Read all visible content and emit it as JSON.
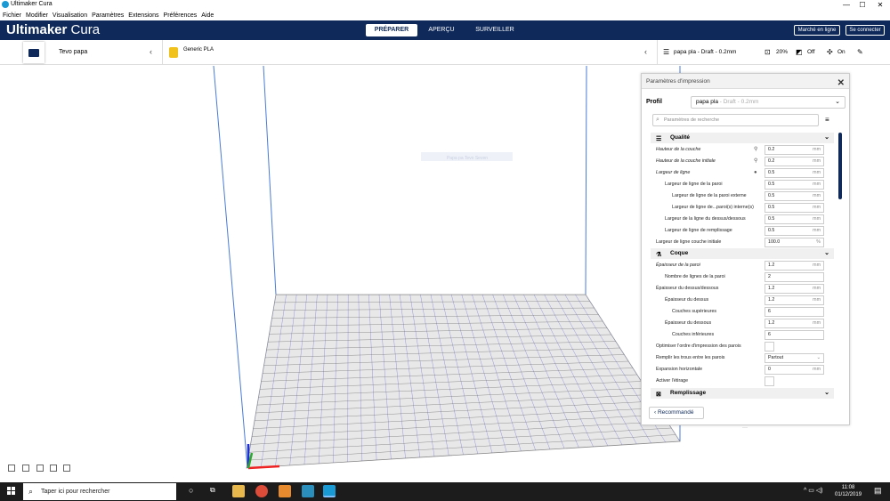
{
  "window": {
    "title": "Ultimaker Cura",
    "minimize": "—",
    "maximize": "☐",
    "close": "✕"
  },
  "menu": [
    "Fichier",
    "Modifier",
    "Visualisation",
    "Paramètres",
    "Extensions",
    "Préférences",
    "Aide"
  ],
  "header": {
    "logo_bold": "Ultimaker",
    "logo_light": " Cura",
    "tabs": [
      "PRÉPARER",
      "APERÇU",
      "SURVEILLER"
    ],
    "marketplace": "Marché en ligne",
    "signin": "Se connecter"
  },
  "toolbar": {
    "printer": "Tevo papa",
    "material": "Generic PLA",
    "profile_summary": "papa pla - Draft - 0.2mm",
    "infill": "20%",
    "support": "Off",
    "adhesion": "On"
  },
  "viewport": {
    "object_label": "Papa pa Tevo Seven"
  },
  "panel": {
    "title": "Paramètres d'impression",
    "close": "✕",
    "profile_label": "Profil",
    "profile_value": "papa pla",
    "profile_muted": " - Draft - 0.2mm",
    "search_placeholder": "Paramètres de recherche",
    "recommended": "‹  Recommandé",
    "categories": {
      "qualite": "Qualité",
      "coque": "Coque",
      "remplissage": "Remplissage"
    },
    "settings": [
      {
        "label": "Hauteur de la couche",
        "value": "0.2",
        "unit": "mm"
      },
      {
        "label": "Hauteur de la couche initiale",
        "value": "0.2",
        "unit": "mm"
      },
      {
        "label": "Largeur de ligne",
        "value": "0.5",
        "unit": "mm"
      },
      {
        "label": "Largeur de ligne de la paroi",
        "value": "0.5",
        "unit": "mm"
      },
      {
        "label": "Largeur de ligne de la paroi externe",
        "value": "0.5",
        "unit": "mm"
      },
      {
        "label": "Largeur de ligne de...paroi(s) interne(s)",
        "value": "0.5",
        "unit": "mm"
      },
      {
        "label": "Largeur de la ligne du dessus/dessous",
        "value": "0.5",
        "unit": "mm"
      },
      {
        "label": "Largeur de ligne de remplissage",
        "value": "0.5",
        "unit": "mm"
      },
      {
        "label": "Largeur de ligne couche initiale",
        "value": "100.0",
        "unit": "%"
      },
      {
        "label": "Épaisseur de la paroi",
        "value": "1.2",
        "unit": "mm"
      },
      {
        "label": "Nombre de lignes de la paroi",
        "value": "2",
        "unit": ""
      },
      {
        "label": "Épaisseur du dessus/dessous",
        "value": "1.2",
        "unit": "mm"
      },
      {
        "label": "Épaisseur du dessus",
        "value": "1.2",
        "unit": "mm"
      },
      {
        "label": "Couches supérieures",
        "value": "6",
        "unit": ""
      },
      {
        "label": "Épaisseur du dessous",
        "value": "1.2",
        "unit": "mm"
      },
      {
        "label": "Couches inférieures",
        "value": "6",
        "unit": ""
      },
      {
        "label": "Optimiser l'ordre d'impression des parois",
        "value": "",
        "unit": ""
      },
      {
        "label": "Remplir les trous entre les parois",
        "value": "Partout",
        "unit": ""
      },
      {
        "label": "Expansion horizontale",
        "value": "0",
        "unit": "mm"
      },
      {
        "label": "Activer l'étirage",
        "value": "",
        "unit": ""
      }
    ]
  },
  "taskbar": {
    "search": "Taper ici pour rechercher",
    "time": "11:08",
    "date": "01/12/2019"
  },
  "colors": {
    "header": "#0f2a5a",
    "accent": "#199ad4",
    "grid": "#5a63d6"
  }
}
